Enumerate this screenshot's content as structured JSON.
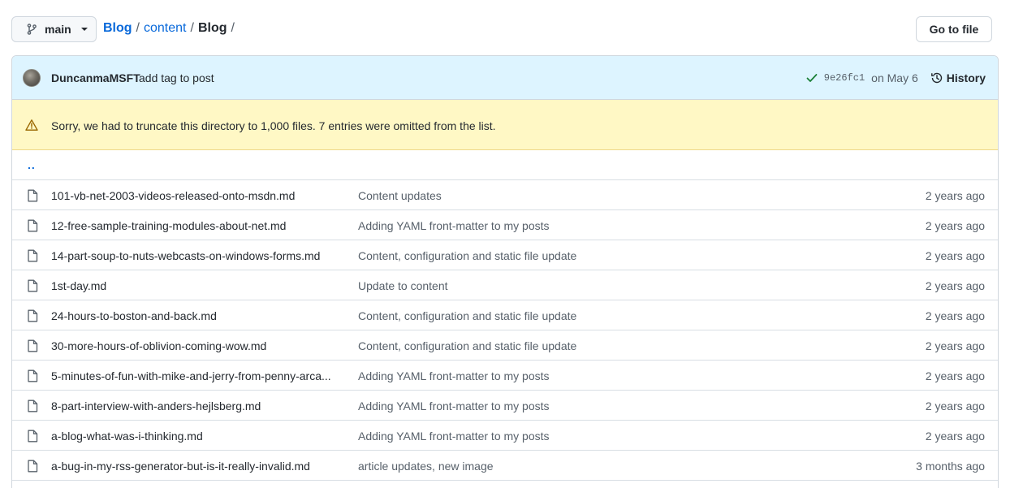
{
  "branch": {
    "name": "main"
  },
  "breadcrumb": {
    "repo": "Blog",
    "sep1": "/",
    "folder": "content",
    "sep2": "/",
    "current": "Blog",
    "sep3": "/"
  },
  "actions": {
    "go_to_file": "Go to file"
  },
  "commit": {
    "author": "DuncanmaMSFT",
    "message": "add tag to post",
    "sha": "9e26fc1",
    "date": "on May 6",
    "history_label": "History"
  },
  "warning": {
    "text": "Sorry, we had to truncate this directory to 1,000 files. 7 entries were omitted from the list."
  },
  "parent_link": "..",
  "files": [
    {
      "name": "101-vb-net-2003-videos-released-onto-msdn.md",
      "commit": "Content updates",
      "age": "2 years ago"
    },
    {
      "name": "12-free-sample-training-modules-about-net.md",
      "commit": "Adding YAML front-matter to my posts",
      "age": "2 years ago"
    },
    {
      "name": "14-part-soup-to-nuts-webcasts-on-windows-forms.md",
      "commit": "Content, configuration and static file update",
      "age": "2 years ago"
    },
    {
      "name": "1st-day.md",
      "commit": "Update to content",
      "age": "2 years ago"
    },
    {
      "name": "24-hours-to-boston-and-back.md",
      "commit": "Content, configuration and static file update",
      "age": "2 years ago"
    },
    {
      "name": "30-more-hours-of-oblivion-coming-wow.md",
      "commit": "Content, configuration and static file update",
      "age": "2 years ago"
    },
    {
      "name": "5-minutes-of-fun-with-mike-and-jerry-from-penny-arca...",
      "commit": "Adding YAML front-matter to my posts",
      "age": "2 years ago"
    },
    {
      "name": "8-part-interview-with-anders-hejlsberg.md",
      "commit": "Adding YAML front-matter to my posts",
      "age": "2 years ago"
    },
    {
      "name": "a-blog-what-was-i-thinking.md",
      "commit": "Adding YAML front-matter to my posts",
      "age": "2 years ago"
    },
    {
      "name": "a-bug-in-my-rss-generator-but-is-it-really-invalid.md",
      "commit": "article updates, new image",
      "age": "3 months ago"
    }
  ],
  "colors": {
    "link": "#0969da",
    "check": "#1a7f37",
    "warning_bg": "#fff8c5",
    "commit_bar_bg": "#ddf4ff"
  },
  "icons": {
    "branch": "git-branch-icon",
    "check": "check-icon",
    "history": "history-icon",
    "warning": "alert-icon",
    "file": "file-icon"
  }
}
